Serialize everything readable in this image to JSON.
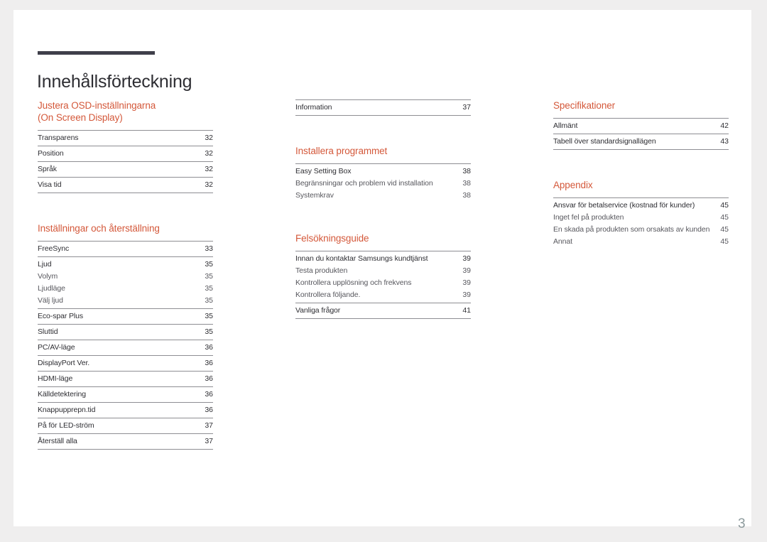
{
  "document": {
    "title": "Innehållsförteckning",
    "page_number": "3",
    "accent_color": "#d4583a",
    "rule_color": "#8e8e93",
    "title_bar_color": "#3f3f4a",
    "page_number_color": "#8d9a9c"
  },
  "columns": [
    {
      "id": "column-1",
      "sections": [
        {
          "heading": "Justera OSD-inställningarna\n(On Screen Display)",
          "heading_line_1": "Justera OSD-inställningarna",
          "heading_line_2": "(On Screen Display)",
          "groups": [
            {
              "entries": [
                {
                  "label": "Transparens",
                  "page": "32",
                  "level": "parent"
                }
              ]
            },
            {
              "entries": [
                {
                  "label": "Position",
                  "page": "32",
                  "level": "parent"
                }
              ]
            },
            {
              "entries": [
                {
                  "label": "Språk",
                  "page": "32",
                  "level": "parent"
                }
              ]
            },
            {
              "entries": [
                {
                  "label": "Visa tid",
                  "page": "32",
                  "level": "parent"
                }
              ]
            }
          ]
        },
        {
          "heading_line_1": "Inställningar och återställning",
          "heading_line_2": "",
          "groups": [
            {
              "entries": [
                {
                  "label": "FreeSync",
                  "page": "33",
                  "level": "parent"
                }
              ]
            },
            {
              "entries": [
                {
                  "label": "Ljud",
                  "page": "35",
                  "level": "parent"
                },
                {
                  "label": "Volym",
                  "page": "35",
                  "level": "child"
                },
                {
                  "label": "Ljudläge",
                  "page": "35",
                  "level": "child"
                },
                {
                  "label": "Välj ljud",
                  "page": "35",
                  "level": "child"
                }
              ]
            },
            {
              "entries": [
                {
                  "label": "Eco-spar Plus",
                  "page": "35",
                  "level": "parent"
                }
              ]
            },
            {
              "entries": [
                {
                  "label": "Sluttid",
                  "page": "35",
                  "level": "parent"
                }
              ]
            },
            {
              "entries": [
                {
                  "label": "PC/AV-läge",
                  "page": "36",
                  "level": "parent"
                }
              ]
            },
            {
              "entries": [
                {
                  "label": "DisplayPort Ver.",
                  "page": "36",
                  "level": "parent"
                }
              ]
            },
            {
              "entries": [
                {
                  "label": "HDMI-läge",
                  "page": "36",
                  "level": "parent"
                }
              ]
            },
            {
              "entries": [
                {
                  "label": "Källdetektering",
                  "page": "36",
                  "level": "parent"
                }
              ]
            },
            {
              "entries": [
                {
                  "label": "Knappupprepn.tid",
                  "page": "36",
                  "level": "parent"
                }
              ]
            },
            {
              "entries": [
                {
                  "label": "På för LED-ström",
                  "page": "37",
                  "level": "parent"
                }
              ]
            },
            {
              "entries": [
                {
                  "label": "Återställ alla",
                  "page": "37",
                  "level": "parent"
                }
              ]
            }
          ]
        }
      ]
    },
    {
      "id": "column-2",
      "sections": [
        {
          "heading_line_1": "",
          "heading_line_2": "",
          "groups": [
            {
              "entries": [
                {
                  "label": "Information",
                  "page": "37",
                  "level": "parent"
                }
              ]
            }
          ]
        },
        {
          "heading_line_1": "Installera programmet",
          "heading_line_2": "",
          "groups": [
            {
              "entries": [
                {
                  "label": "Easy Setting Box",
                  "page": "38",
                  "level": "parent"
                },
                {
                  "label": "Begränsningar och problem vid installation",
                  "page": "38",
                  "level": "child"
                },
                {
                  "label": "Systemkrav",
                  "page": "38",
                  "level": "child"
                }
              ]
            }
          ]
        },
        {
          "heading_line_1": "Felsökningsguide",
          "heading_line_2": "",
          "groups": [
            {
              "entries": [
                {
                  "label": "Innan du kontaktar Samsungs kundtjänst",
                  "page": "39",
                  "level": "parent"
                },
                {
                  "label": "Testa produkten",
                  "page": "39",
                  "level": "child"
                },
                {
                  "label": "Kontrollera upplösning och frekvens",
                  "page": "39",
                  "level": "child"
                },
                {
                  "label": "Kontrollera följande.",
                  "page": "39",
                  "level": "child"
                }
              ]
            },
            {
              "entries": [
                {
                  "label": "Vanliga frågor",
                  "page": "41",
                  "level": "parent"
                }
              ]
            }
          ]
        }
      ]
    },
    {
      "id": "column-3",
      "sections": [
        {
          "heading_line_1": "Specifikationer",
          "heading_line_2": "",
          "groups": [
            {
              "entries": [
                {
                  "label": "Allmänt",
                  "page": "42",
                  "level": "parent"
                }
              ]
            },
            {
              "entries": [
                {
                  "label": "Tabell över standardsignallägen",
                  "page": "43",
                  "level": "parent"
                }
              ]
            }
          ]
        },
        {
          "heading_line_1": "Appendix",
          "heading_line_2": "",
          "groups": [
            {
              "entries": [
                {
                  "label": "Ansvar för betalservice (kostnad för kunder)",
                  "page": "45",
                  "level": "parent"
                },
                {
                  "label": "Inget fel på produkten",
                  "page": "45",
                  "level": "child"
                },
                {
                  "label": "En skada på produkten som orsakats av kunden",
                  "page": "45",
                  "level": "child"
                },
                {
                  "label": "Annat",
                  "page": "45",
                  "level": "child"
                }
              ]
            }
          ]
        }
      ]
    }
  ]
}
